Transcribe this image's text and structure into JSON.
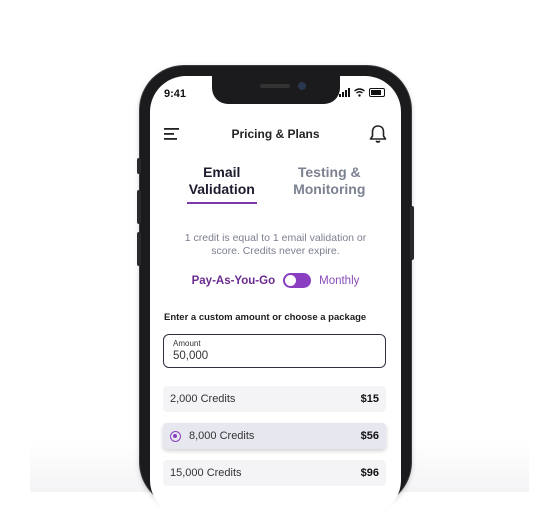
{
  "status_bar": {
    "time": "9:41"
  },
  "header": {
    "title": "Pricing & Plans"
  },
  "tabs": [
    {
      "line1": "Email",
      "line2": "Validation"
    },
    {
      "line1": "Testing &",
      "line2": "Monitoring"
    }
  ],
  "info": {
    "line1": "1 credit is equal to 1 email validation or",
    "line2": "score. Credits never expire."
  },
  "billing": {
    "pay_label": "Pay-As-You-Go",
    "monthly_label": "Monthly",
    "toggle_on": true
  },
  "prompt": "Enter a custom amount or choose a package",
  "amount": {
    "label": "Amount",
    "value": "50,000"
  },
  "packages": [
    {
      "credits": "2,000 Credits",
      "price": "$15"
    },
    {
      "credits": "8,000 Credits",
      "price": "$56",
      "selected": true
    },
    {
      "credits": "15,000 Credits",
      "price": "$96"
    }
  ],
  "colors": {
    "accent": "#8a3fc2",
    "dark": "#1c1c2e",
    "muted": "#7c8090"
  }
}
